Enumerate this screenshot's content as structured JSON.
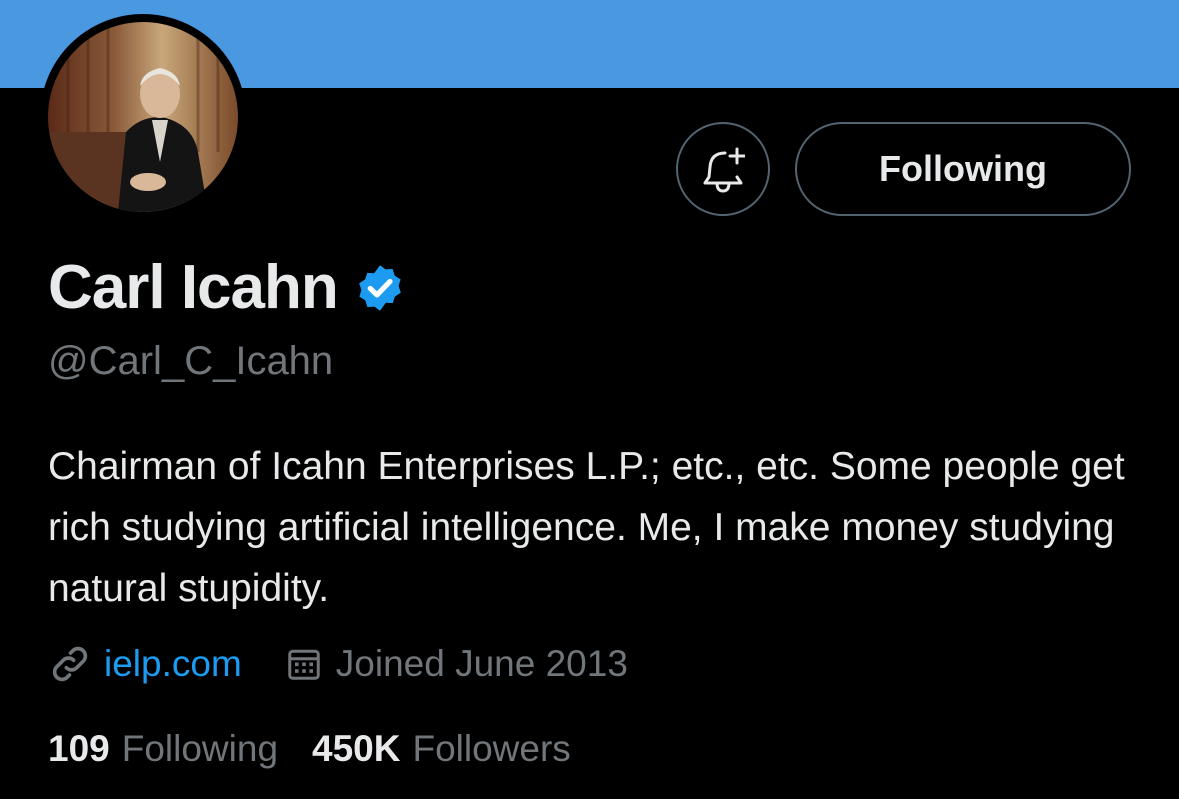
{
  "profile": {
    "display_name": "Carl Icahn",
    "handle": "@Carl_C_Icahn",
    "verified": true,
    "bio": "Chairman of Icahn Enterprises L.P.; etc., etc. Some people get rich studying artificial intelligence. Me, I make money studying natural stupidity.",
    "link": "ielp.com",
    "joined": "Joined June 2013"
  },
  "actions": {
    "notify_icon": "bell-plus-icon",
    "following_label": "Following"
  },
  "stats": {
    "following_count": "109",
    "following_label": "Following",
    "followers_count": "450K",
    "followers_label": "Followers"
  },
  "icons": {
    "verified": "verified-badge-icon",
    "link": "link-icon",
    "calendar": "calendar-icon"
  },
  "colors": {
    "background": "#000000",
    "banner": "#4a98e0",
    "accent": "#1d9bf0",
    "text_primary": "#e7e9ea",
    "text_secondary": "#71767b",
    "border": "#536471"
  }
}
